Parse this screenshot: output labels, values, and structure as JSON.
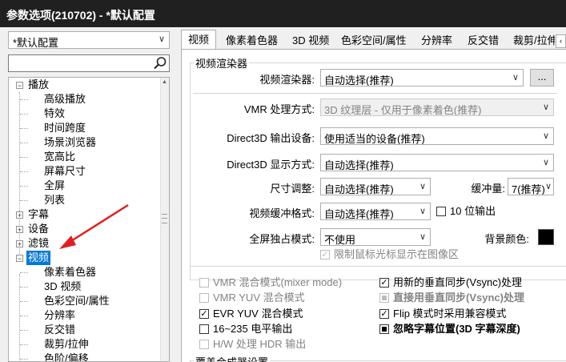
{
  "window": {
    "title": "参数选项(210702) - *默认配置"
  },
  "left": {
    "profile_value": "*默认配置",
    "search_placeholder": "",
    "tree": {
      "playback": "播放",
      "playback_children": [
        "高级播放",
        "特效",
        "时间跨度",
        "场景浏览器",
        "宽高比",
        "屏幕尺寸",
        "全屏",
        "列表"
      ],
      "subtitle": "字幕",
      "device": "设备",
      "filter": "滤镜",
      "video": "视频",
      "video_children": [
        "像素着色器",
        "3D 视频",
        "色彩空间/属性",
        "分辨率",
        "反交错",
        "裁剪/拉伸",
        "色阶/偏移"
      ]
    }
  },
  "tabs": [
    "视频",
    "像素着色器",
    "3D 视频",
    "色彩空间/属性",
    "分辨率",
    "反交错",
    "裁剪/拉伸"
  ],
  "renderer_group": {
    "title": "视频渲染器",
    "renderer_label": "视频渲染器:",
    "renderer_value": "自动选择(推荐)",
    "more_button": "...",
    "vmr_mode_label": "VMR 处理方式:",
    "vmr_mode_value": "3D 纹理层 - 仅用于像素着色(推荐)",
    "d3d_device_label": "Direct3D 输出设备:",
    "d3d_device_value": "使用适当的设备(推荐)",
    "d3d_display_label": "Direct3D 显示方式:",
    "d3d_display_value": "自动选择(推荐)",
    "resize_label": "尺寸调整:",
    "resize_value": "自动选择(推荐)",
    "buffer_label": "缓冲量:",
    "buffer_value": "7(推荐)",
    "surface_label": "视频缓冲格式:",
    "surface_value": "自动选择(推荐)",
    "ten_bit_label": "10 位输出",
    "fullscreen_label": "全屏独占模式:",
    "fullscreen_value": "不使用",
    "bgcolor_label": "背景颜色:",
    "bgcolor": "#000000",
    "limit_cursor_label": "限制鼠标光标显示在图像区"
  },
  "options": {
    "vmr_mixer": "VMR 混合模式(mixer mode)",
    "vmr_yuv": "VMR YUV 混合模式",
    "evr_yuv": "EVR YUV 混合模式",
    "range_16_235": "16~235 电平输出",
    "hw_hdr": "H/W 处理 HDR 输出",
    "new_vsync": "用新的垂直同步(Vsync)处理",
    "direct_vsync": "直接用垂直同步(Vsync)处理",
    "flip_mode": "Flip 模式时采用兼容模式",
    "ignore_3d_sub": "忽略字幕位置(3D 字幕深度)"
  },
  "overlay_group": {
    "title": "覆盖合成器设置"
  },
  "colors": {
    "titlebar": "#202020",
    "selection": "#0078d7",
    "annotation_arrow": "#e02020"
  }
}
